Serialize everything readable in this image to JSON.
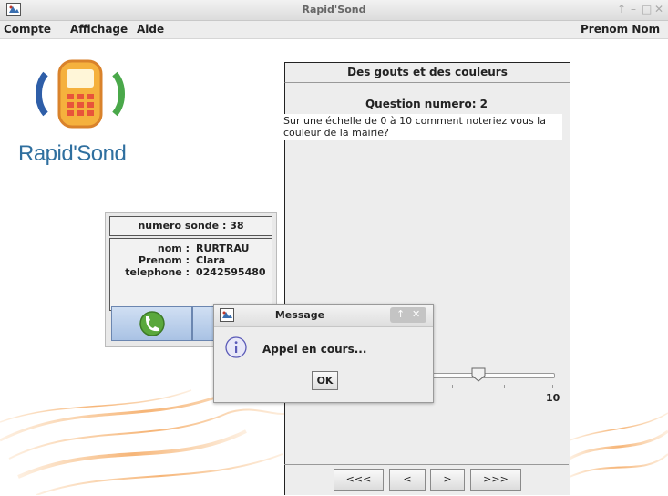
{
  "window": {
    "title": "Rapid'Sond"
  },
  "menu": {
    "items": [
      "Compte",
      "Affichage",
      "Aide"
    ],
    "user": "Prenom Nom"
  },
  "logo": {
    "text": "Rapid'Sond"
  },
  "survey": {
    "header": "Des gouts et des couleurs",
    "question_title": "Question numero: 2",
    "question_text": "Sur une échelle de 0 à 10 comment noteriez vous la couleur de la mairie?",
    "slider": {
      "value": 5,
      "min": 0,
      "max": 10,
      "max_label": "10"
    },
    "nav": {
      "first": "<<<",
      "prev": "<",
      "next": ">",
      "last": ">>>"
    }
  },
  "contact": {
    "header": "numero sonde : 38",
    "nom_label": "nom :",
    "nom_value": "RURTRAU",
    "prenom_label": "Prenom :",
    "prenom_value": "Clara",
    "tel_label": "telephone :",
    "tel_value": "0242595480"
  },
  "dialog": {
    "title": "Message",
    "message": "Appel en cours...",
    "ok": "OK"
  },
  "icons": {
    "app": "app-icon",
    "call": "phone-icon",
    "info": "info-icon"
  }
}
